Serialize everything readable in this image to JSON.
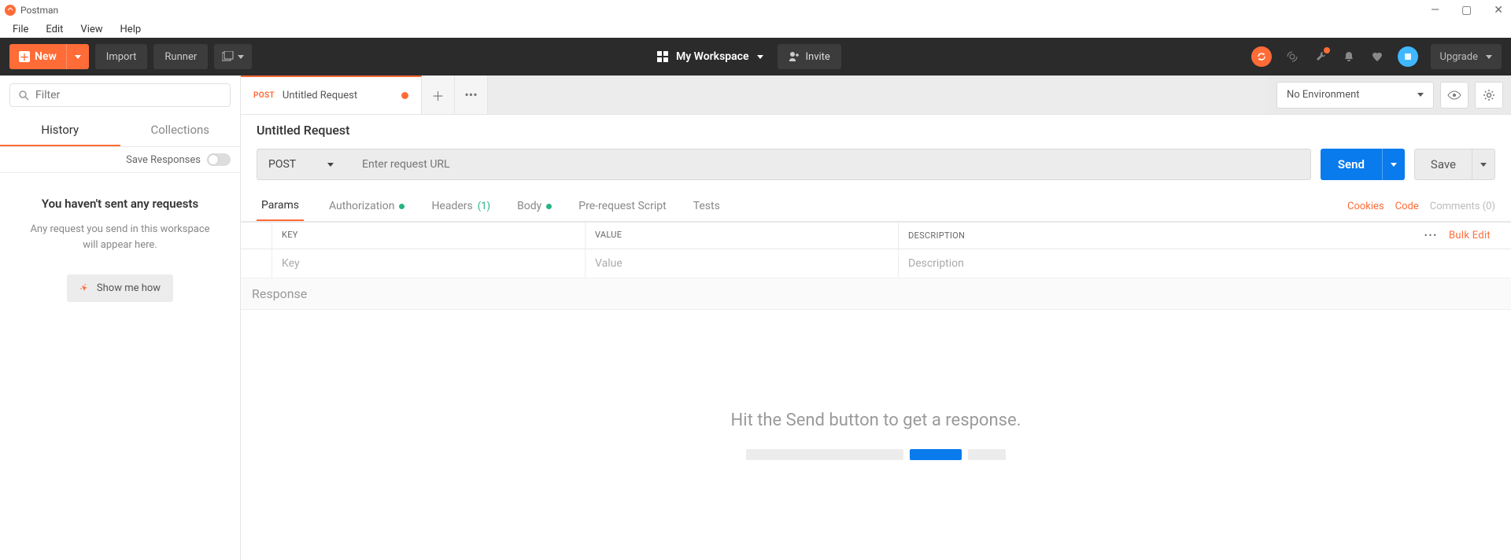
{
  "titlebar": {
    "app_name": "Postman"
  },
  "menubar": [
    "File",
    "Edit",
    "View",
    "Help"
  ],
  "toolbar": {
    "new_label": "New",
    "import_label": "Import",
    "runner_label": "Runner",
    "workspace_label": "My Workspace",
    "invite_label": "Invite",
    "upgrade_label": "Upgrade"
  },
  "sidebar": {
    "filter_placeholder": "Filter",
    "tabs": {
      "history": "History",
      "collections": "Collections"
    },
    "save_responses_label": "Save Responses",
    "empty_heading": "You haven't sent any requests",
    "empty_text": "Any request you send in this workspace will appear here.",
    "show_how_label": "Show me how"
  },
  "request": {
    "tab_method": "POST",
    "tab_name": "Untitled Request",
    "title": "Untitled Request",
    "method": "POST",
    "url_placeholder": "Enter request URL",
    "send_label": "Send",
    "save_label": "Save"
  },
  "env": {
    "selected": "No Environment"
  },
  "param_tabs": {
    "params": "Params",
    "authorization": "Authorization",
    "headers": "Headers",
    "headers_count": "(1)",
    "body": "Body",
    "prerequest": "Pre-request Script",
    "tests": "Tests"
  },
  "right_links": {
    "cookies": "Cookies",
    "code": "Code",
    "comments": "Comments (0)"
  },
  "params_table": {
    "headers": {
      "key": "KEY",
      "value": "VALUE",
      "desc": "DESCRIPTION"
    },
    "bulk_edit": "Bulk Edit",
    "placeholders": {
      "key": "Key",
      "value": "Value",
      "desc": "Description"
    }
  },
  "response": {
    "title": "Response",
    "hint": "Hit the Send button to get a response."
  }
}
